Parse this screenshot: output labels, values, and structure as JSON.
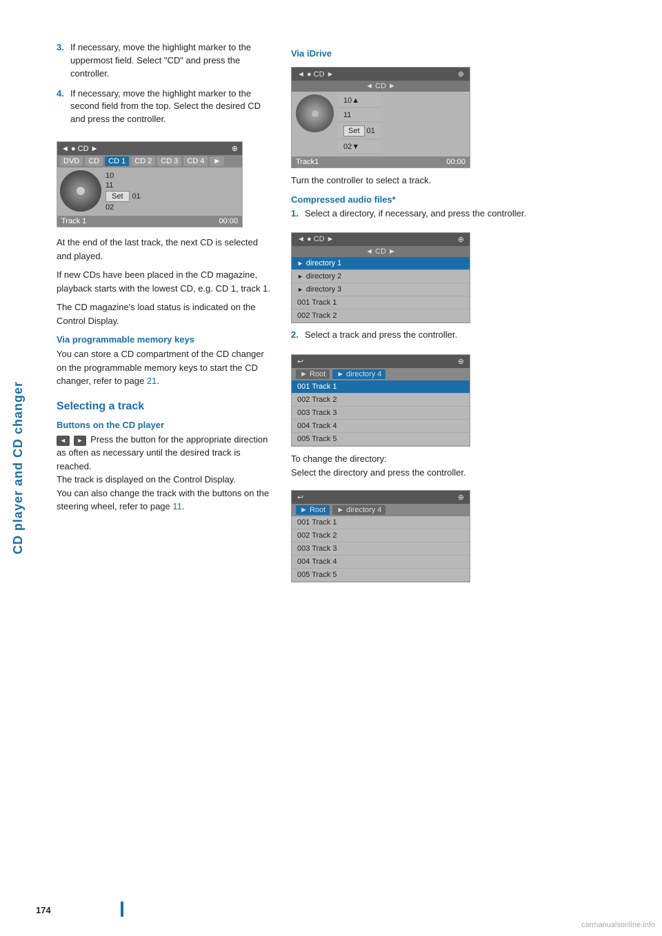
{
  "sidebar": {
    "label": "CD player and CD changer"
  },
  "page_number": "174",
  "left_col": {
    "steps": [
      {
        "num": "3.",
        "text": "If necessary, move the highlight marker to the uppermost field. Select \"CD\" and press the controller."
      },
      {
        "num": "4.",
        "text": "If necessary, move the highlight marker to the second field from the top. Select the desired CD and press the controller."
      }
    ],
    "cd_ui_1": {
      "topbar_left": "◄ ● CD ►",
      "topbar_right": "◄◄►",
      "tabs": [
        "DVD",
        "CD",
        "CD 1",
        "CD 2",
        "CD 3",
        "CD 4",
        "►"
      ],
      "active_tab": "CD 1",
      "track_nums": [
        "10",
        "11",
        "01",
        "02"
      ],
      "set_label": "Set",
      "footer_left": "Track 1",
      "footer_right": "00:00"
    },
    "body_paragraphs": [
      "At the end of the last track, the next CD is selected and played.",
      "If new CDs have been placed in the CD magazine, playback starts with the lowest CD, e.g. CD 1, track 1.",
      "The CD magazine's load status is indicated on the Control Display."
    ],
    "via_prog_title": "Via programmable memory keys",
    "via_prog_text": "You can store a CD compartment of the CD changer on the programmable memory keys to start the CD changer, refer to page 21.",
    "selecting_title": "Selecting a track",
    "buttons_title": "Buttons on the CD player",
    "buttons_text": "Press the button for the appropriate direction as often as necessary until the desired track is reached.\nThe track is displayed on the Control Display.\nYou can also change the track with the buttons on the steering wheel, refer to page 11."
  },
  "right_col": {
    "via_idrive_title": "Via iDrive",
    "cd_ui_idrive": {
      "topbar_left": "◄ ● CD ►",
      "topbar_right": "◄◄►",
      "secondbar": "◄ CD ►",
      "track_nums": [
        "10▲",
        "11",
        "01",
        "02▼"
      ],
      "set_label": "Set",
      "footer_left": "Track1",
      "footer_right": "00:00"
    },
    "idrive_text": "Turn the controller to select a track.",
    "compressed_title": "Compressed audio files*",
    "compressed_steps": [
      {
        "num": "1.",
        "text": "Select a directory, if necessary, and press the controller."
      },
      {
        "num": "2.",
        "text": "Select a track and press the controller."
      }
    ],
    "dir_ui": {
      "topbar_left": "◄ ● CD ►",
      "topbar_right": "◄◄►",
      "secondbar": "◄ CD ►",
      "rows": [
        {
          "label": "directory 1",
          "highlighted": true
        },
        {
          "label": "directory 2",
          "highlighted": false
        },
        {
          "label": "directory 3",
          "highlighted": false
        },
        {
          "label": "001 Track  1",
          "highlighted": false
        },
        {
          "label": "002 Track  2",
          "highlighted": false
        }
      ]
    },
    "track_ui_1": {
      "topbar_left": "↩",
      "topbar_right": "◄◄►",
      "breadcrumb": [
        "Root",
        "directory 4"
      ],
      "rows": [
        {
          "label": "001 Track  1",
          "highlighted": true
        },
        {
          "label": "002 Track  2",
          "highlighted": false
        },
        {
          "label": "003 Track  3",
          "highlighted": false
        },
        {
          "label": "004 Track  4",
          "highlighted": false
        },
        {
          "label": "005 Track  5",
          "highlighted": false
        }
      ]
    },
    "change_dir_text": "To change the directory:\nSelect the directory and press the controller.",
    "track_ui_2": {
      "topbar_left": "↩",
      "topbar_right": "◄◄►",
      "breadcrumb": [
        "Root",
        "directory 4"
      ],
      "breadcrumb_active": 0,
      "rows": [
        {
          "label": "001 Track  1",
          "highlighted": false
        },
        {
          "label": "002 Track  2",
          "highlighted": false
        },
        {
          "label": "003 Track  3",
          "highlighted": false
        },
        {
          "label": "004 Track  4",
          "highlighted": false
        },
        {
          "label": "005 Track  5",
          "highlighted": false
        }
      ]
    }
  },
  "watermark": "carmanualsonline.info"
}
